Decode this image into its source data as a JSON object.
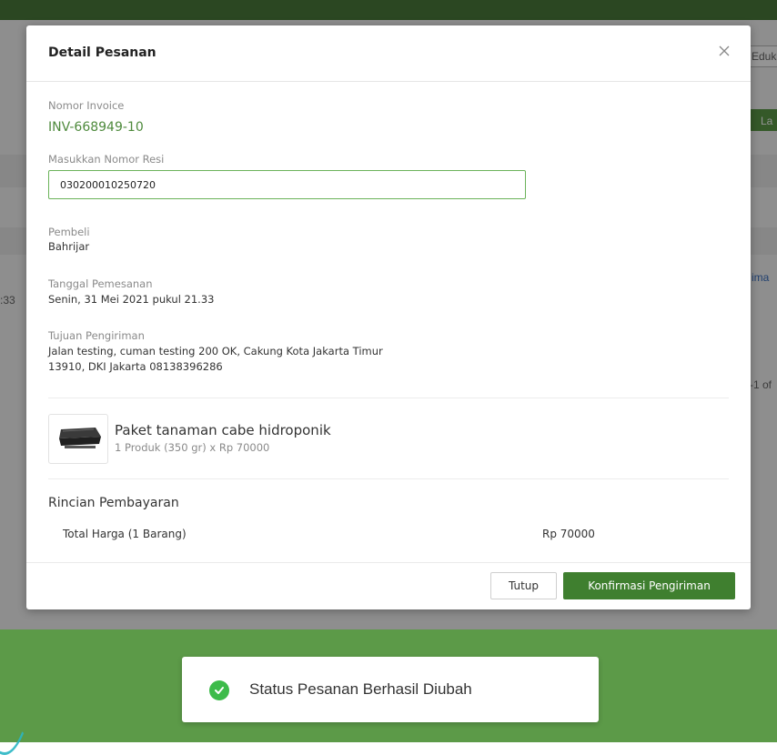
{
  "background": {
    "partial_texts": [
      "Eduk",
      "La",
      "ima",
      "-1 of",
      ":33"
    ]
  },
  "modal": {
    "title": "Detail Pesanan",
    "invoice": {
      "label": "Nomor Invoice",
      "value": "INV-668949-10"
    },
    "resi": {
      "label": "Masukkan Nomor Resi",
      "value": "030200010250720"
    },
    "buyer": {
      "label": "Pembeli",
      "value": "Bahrijar"
    },
    "order_date": {
      "label": "Tanggal Pemesanan",
      "value": "Senin, 31 Mei 2021 pukul 21.33"
    },
    "shipping": {
      "label": "Tujuan Pengiriman",
      "line1": "Jalan testing, cuman testing 200 OK, Cakung Kota Jakarta Timur",
      "line2": "13910, DKI Jakarta 08138396286"
    },
    "product": {
      "name": "Paket tanaman cabe hidroponik",
      "meta": "1 Produk (350 gr) x Rp 70000"
    },
    "payment": {
      "title": "Rincian Pembayaran",
      "total_label": "Total Harga (1 Barang)",
      "total_value": "Rp 70000"
    },
    "buttons": {
      "close_label": "Tutup",
      "confirm_label": "Konfirmasi Pengiriman"
    }
  },
  "toast": {
    "message": "Status Pesanan Berhasil Diubah"
  },
  "colors": {
    "brand_green": "#3f7f2f",
    "invoice_green": "#4e8a3c",
    "success_green": "#3dbb4a"
  }
}
